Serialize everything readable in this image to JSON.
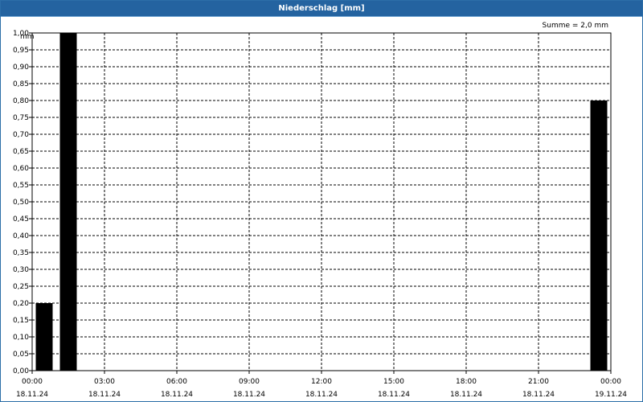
{
  "window": {
    "title": "Niederschlag [mm]"
  },
  "summary": "Summe = 2,0 mm",
  "chart_data": {
    "type": "bar",
    "title": "Niederschlag [mm]",
    "ylabel": "mm",
    "ylim": [
      0,
      1.0
    ],
    "yticks": [
      0,
      0.05,
      0.1,
      0.15,
      0.2,
      0.25,
      0.3,
      0.35,
      0.4,
      0.45,
      0.5,
      0.55,
      0.6,
      0.65,
      0.7,
      0.75,
      0.8,
      0.85,
      0.9,
      0.95,
      1.0
    ],
    "ytick_labels": [
      "0,00",
      "0,05",
      "0,10",
      "0,15",
      "0,20",
      "0,25",
      "0,30",
      "0,35",
      "0,40",
      "0,45",
      "0,50",
      "0,55",
      "0,60",
      "0,65",
      "0,70",
      "0,75",
      "0,80",
      "0,85",
      "0,90",
      "0,95",
      "1,00"
    ],
    "xlim": [
      "2024-11-18T00:00",
      "2024-11-19T00:00"
    ],
    "xticks": [
      {
        "at": "2024-11-18T00:00",
        "time": "00:00",
        "date": "18.11.24"
      },
      {
        "at": "2024-11-18T03:00",
        "time": "03:00",
        "date": "18.11.24"
      },
      {
        "at": "2024-11-18T06:00",
        "time": "06:00",
        "date": "18.11.24"
      },
      {
        "at": "2024-11-18T09:00",
        "time": "09:00",
        "date": "18.11.24"
      },
      {
        "at": "2024-11-18T12:00",
        "time": "12:00",
        "date": "18.11.24"
      },
      {
        "at": "2024-11-18T15:00",
        "time": "15:00",
        "date": "18.11.24"
      },
      {
        "at": "2024-11-18T18:00",
        "time": "18:00",
        "date": "18.11.24"
      },
      {
        "at": "2024-11-18T21:00",
        "time": "21:00",
        "date": "18.11.24"
      },
      {
        "at": "2024-11-19T00:00",
        "time": "00:00",
        "date": "19.11.24"
      }
    ],
    "bars": [
      {
        "start": "2024-11-18T00:00",
        "end": "2024-11-18T01:00",
        "value": 0.2
      },
      {
        "start": "2024-11-18T01:00",
        "end": "2024-11-18T02:00",
        "value": 1.0
      },
      {
        "start": "2024-11-18T23:00",
        "end": "2024-11-19T00:00",
        "value": 0.8
      }
    ],
    "grid": true,
    "bar_color": "#000000"
  }
}
